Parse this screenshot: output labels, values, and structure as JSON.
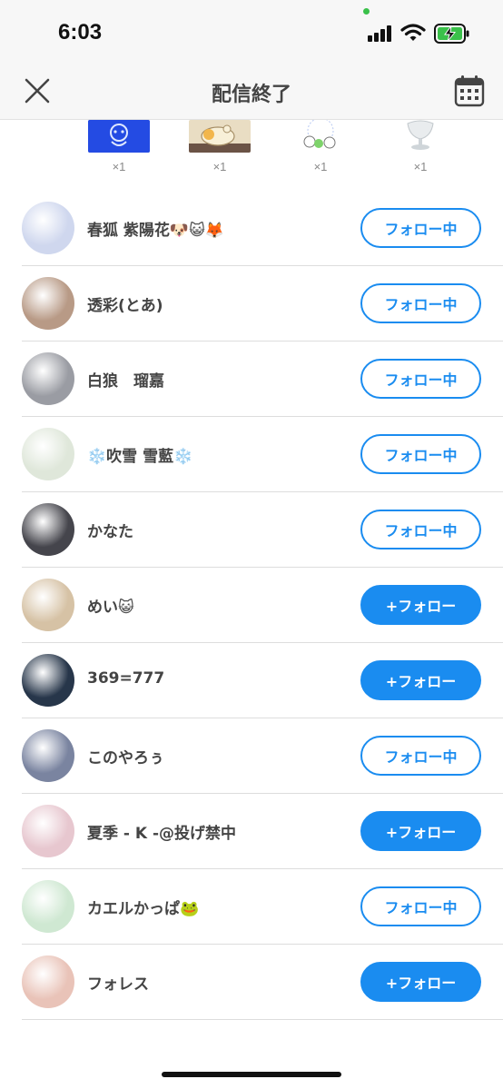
{
  "status_bar": {
    "time": "6:03"
  },
  "nav": {
    "title": "配信終了"
  },
  "gifts": [
    {
      "icon": "blue-character-gift",
      "count": "×1"
    },
    {
      "icon": "sleeping-creature-gift",
      "count": "×1"
    },
    {
      "icon": "small-characters-gift",
      "count": "×1"
    },
    {
      "icon": "glass-cup-gift",
      "count": "×1"
    }
  ],
  "users": [
    {
      "name": "春狐 紫陽花🐶😺🦊",
      "button": "フォロー中",
      "state": "following",
      "avatar_color": "#cfd7ee"
    },
    {
      "name": "透彩(とあ)",
      "button": "フォロー中",
      "state": "following",
      "avatar_color": "#b89a86"
    },
    {
      "name": "白狼　瑠嘉",
      "button": "フォロー中",
      "state": "following",
      "avatar_color": "#9a9ca3"
    },
    {
      "name": "❄️吹雪 雪藍❄️",
      "button": "フォロー中",
      "state": "following",
      "avatar_color": "#dfe7da"
    },
    {
      "name": "かなた",
      "button": "フォロー中",
      "state": "following",
      "avatar_color": "#45454c"
    },
    {
      "name": "めい😺",
      "button": "+フォロー",
      "state": "not_following",
      "avatar_color": "#d6c2a5"
    },
    {
      "name": "369=777",
      "button": "+フォロー",
      "state": "not_following",
      "avatar_color": "#27364a"
    },
    {
      "name": "このやろぅ",
      "button": "フォロー中",
      "state": "following",
      "avatar_color": "#7a84a0"
    },
    {
      "name": "夏季 - K -@投げ禁中",
      "button": "+フォロー",
      "state": "not_following",
      "avatar_color": "#e7c7cf"
    },
    {
      "name": "カエルかっぱ🐸",
      "button": "フォロー中",
      "state": "following",
      "avatar_color": "#cfe8d2"
    },
    {
      "name": "フォレス",
      "button": "+フォロー",
      "state": "not_following",
      "avatar_color": "#e9c3b8"
    }
  ],
  "colors": {
    "accent": "#1a8cf0"
  }
}
